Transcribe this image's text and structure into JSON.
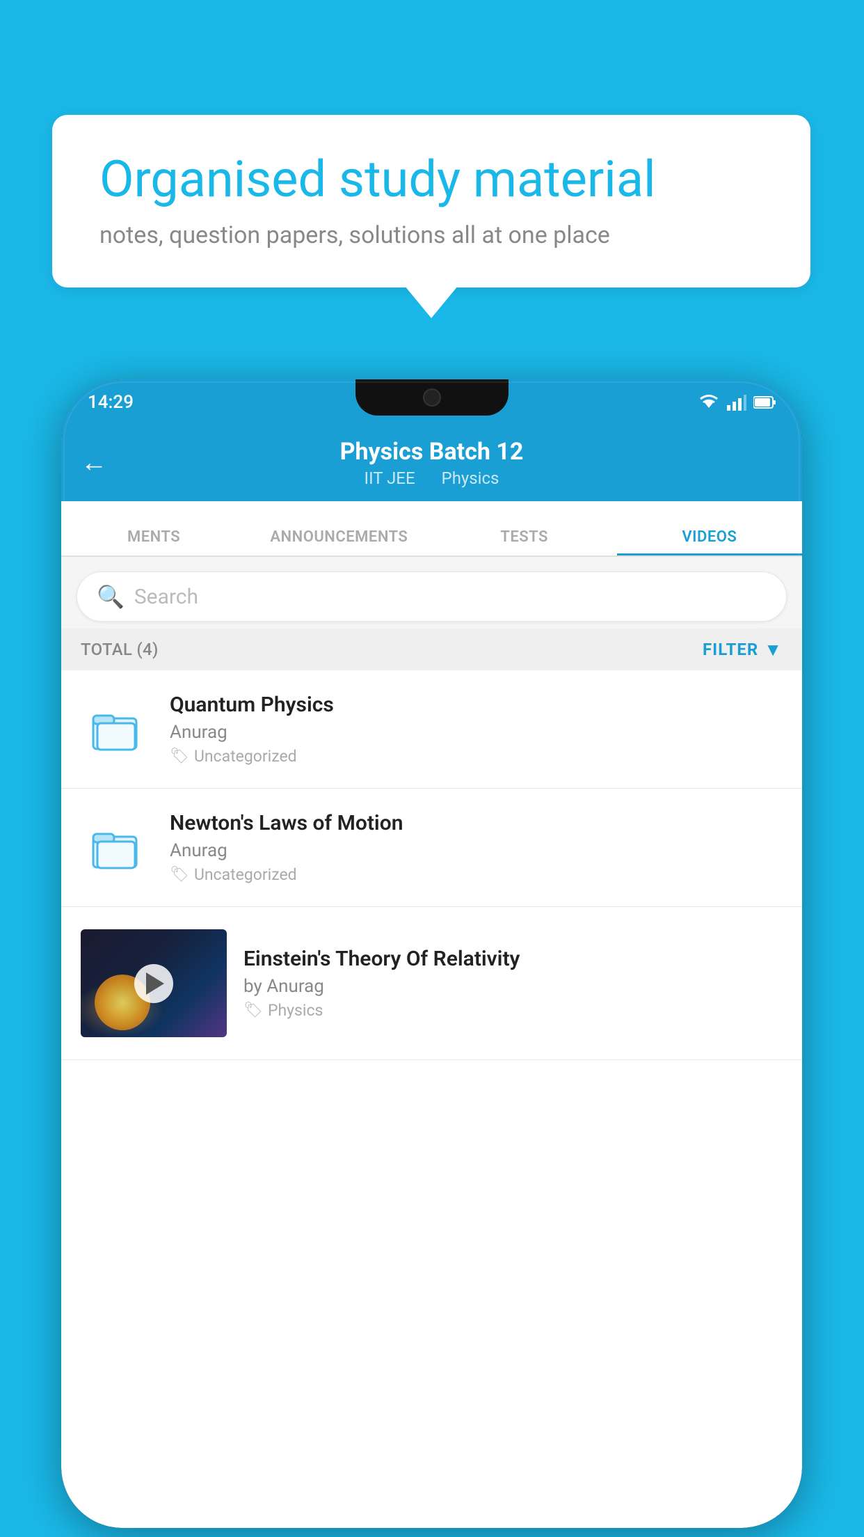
{
  "background_color": "#1ab8e8",
  "speech_bubble": {
    "headline": "Organised study material",
    "subtext": "notes, question papers, solutions all at one place"
  },
  "phone": {
    "status_bar": {
      "time": "14:29",
      "icons": [
        "wifi",
        "signal",
        "battery"
      ]
    },
    "top_bar": {
      "title": "Physics Batch 12",
      "subtitle_part1": "IIT JEE",
      "subtitle_part2": "Physics",
      "back_label": "←"
    },
    "tabs": [
      {
        "label": "MENTS",
        "active": false
      },
      {
        "label": "ANNOUNCEMENTS",
        "active": false
      },
      {
        "label": "TESTS",
        "active": false
      },
      {
        "label": "VIDEOS",
        "active": true
      }
    ],
    "search": {
      "placeholder": "Search"
    },
    "filter_row": {
      "total_label": "TOTAL (4)",
      "filter_label": "FILTER"
    },
    "video_list": [
      {
        "id": 1,
        "title": "Quantum Physics",
        "author": "Anurag",
        "tag": "Uncategorized",
        "has_thumbnail": false
      },
      {
        "id": 2,
        "title": "Newton's Laws of Motion",
        "author": "Anurag",
        "tag": "Uncategorized",
        "has_thumbnail": false
      },
      {
        "id": 3,
        "title": "Einstein's Theory Of Relativity",
        "author": "by Anurag",
        "tag": "Physics",
        "has_thumbnail": true
      }
    ]
  }
}
